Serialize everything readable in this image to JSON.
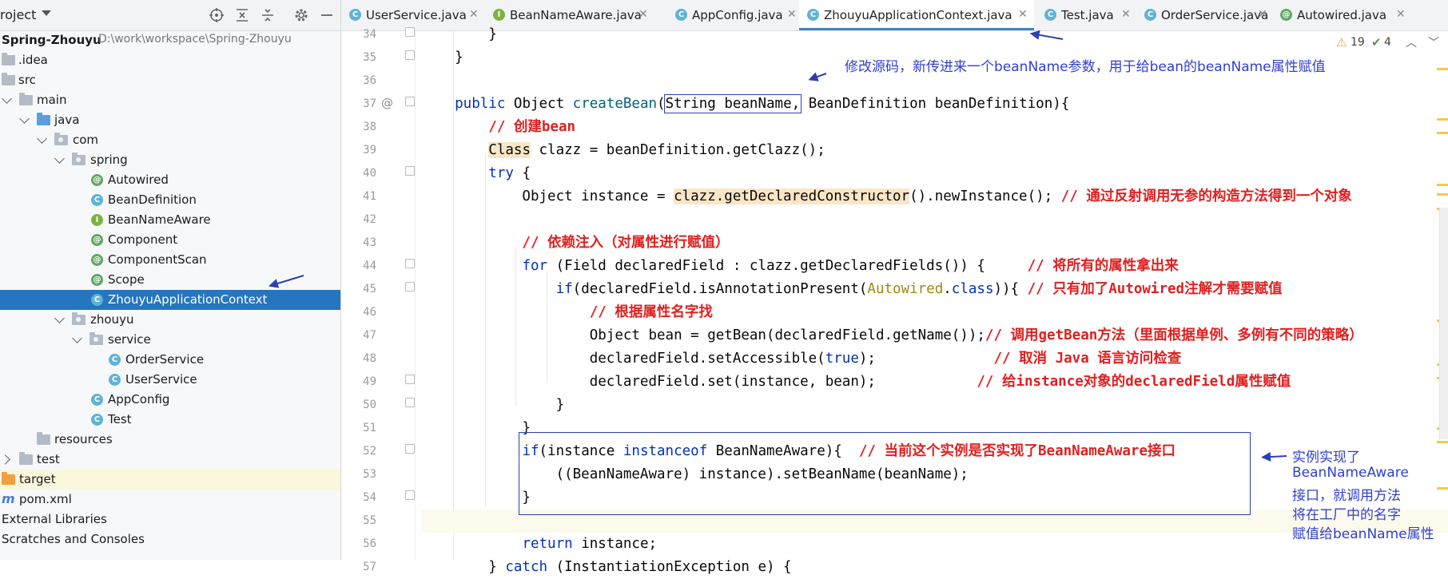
{
  "project_panel": {
    "title": "roject",
    "root": {
      "name": "Spring-Zhouyu",
      "path": "D:\\work\\workspace\\Spring-Zhouyu"
    },
    "tree": [
      {
        "label": ".idea",
        "kind": "folder"
      },
      {
        "label": "src",
        "kind": "folder"
      },
      {
        "label": "main",
        "kind": "folder"
      },
      {
        "label": "java",
        "kind": "src-folder"
      },
      {
        "label": "com",
        "kind": "package"
      },
      {
        "label": "spring",
        "kind": "package"
      },
      {
        "label": "Autowired",
        "kind": "annotation"
      },
      {
        "label": "BeanDefinition",
        "kind": "class"
      },
      {
        "label": "BeanNameAware",
        "kind": "interface"
      },
      {
        "label": "Component",
        "kind": "annotation"
      },
      {
        "label": "ComponentScan",
        "kind": "annotation"
      },
      {
        "label": "Scope",
        "kind": "annotation"
      },
      {
        "label": "ZhouyuApplicationContext",
        "kind": "class"
      },
      {
        "label": "zhouyu",
        "kind": "package"
      },
      {
        "label": "service",
        "kind": "package"
      },
      {
        "label": "OrderService",
        "kind": "class"
      },
      {
        "label": "UserService",
        "kind": "class"
      },
      {
        "label": "AppConfig",
        "kind": "class"
      },
      {
        "label": "Test",
        "kind": "class"
      },
      {
        "label": "resources",
        "kind": "folder"
      },
      {
        "label": "test",
        "kind": "folder"
      },
      {
        "label": "target",
        "kind": "target-folder"
      },
      {
        "label": "pom.xml",
        "kind": "maven"
      },
      {
        "label": "External Libraries",
        "kind": "libs"
      },
      {
        "label": "Scratches and Consoles",
        "kind": "scratch"
      }
    ],
    "selected": "ZhouyuApplicationContext"
  },
  "tabs": [
    {
      "label": "UserService.java",
      "icon": "class-icon",
      "active": false
    },
    {
      "label": "BeanNameAware.java",
      "icon": "interface-icon",
      "active": false
    },
    {
      "label": "AppConfig.java",
      "icon": "class-icon",
      "active": false
    },
    {
      "label": "ZhouyuApplicationContext.java",
      "icon": "class-icon",
      "active": true
    },
    {
      "label": "Test.java",
      "icon": "class-icon",
      "active": false
    },
    {
      "label": "OrderService.java",
      "icon": "class-icon",
      "active": false
    },
    {
      "label": "Autowired.java",
      "icon": "annotation-icon",
      "active": false
    }
  ],
  "inspections": {
    "warnings": "19",
    "ok": "4"
  },
  "line_numbers": [
    "34",
    "35",
    "36",
    "37",
    "38",
    "39",
    "40",
    "41",
    "42",
    "43",
    "44",
    "45",
    "46",
    "47",
    "48",
    "49",
    "50",
    "51",
    "52",
    "53",
    "54",
    "55",
    "56",
    "57"
  ],
  "code": {
    "l34": "        }",
    "l35": "    }",
    "l37_a": "    public ",
    "l37_b": "Object ",
    "l37_c": "createBean",
    "l37_d": "(",
    "l37_e": "String beanName,",
    "l37_f": " BeanDefinition beanDefinition){",
    "l38": "        // 创建bean",
    "l39_a": "        ",
    "l39_b": "Class",
    "l39_c": " clazz = beanDefinition.getClazz();",
    "l40_a": "        ",
    "l40_b": "try",
    "l40_c": " {",
    "l41_a": "            Object instance = ",
    "l41_b": "clazz.getDeclaredConstructor",
    "l41_c": "().newInstance(); ",
    "l41_d": "// 通过反射调用无参的构造方法得到一个对象",
    "l43": "            // 依赖注入（对属性进行赋值）",
    "l44_a": "            ",
    "l44_b": "for",
    "l44_c": " (Field declaredField : clazz.getDeclaredFields()) {     ",
    "l44_d": "// 将所有的属性拿出来",
    "l45_a": "                ",
    "l45_b": "if",
    "l45_c": "(declaredField.isAnnotationPresent(",
    "l45_d": "Autowired",
    "l45_e": ".",
    "l45_f": "class",
    "l45_g": ")){ ",
    "l45_h": "// 只有加了Autowired注解才需要赋值",
    "l46": "                    // 根据属性名字找",
    "l47_a": "                    Object bean = getBean(declaredField.getName());",
    "l47_b": "// 调用getBean方法（里面根据单例、多例有不同的策略）",
    "l48_a": "                    declaredField.setAccessible(",
    "l48_b": "true",
    "l48_c": ");              ",
    "l48_d": "// 取消 Java 语言访问检查",
    "l49_a": "                    declaredField.set(instance, bean);            ",
    "l49_b": "// 给instance对象的declaredField属性赋值",
    "l50": "                }",
    "l51": "            }",
    "l52_a": "            ",
    "l52_b": "if",
    "l52_c": "(instance ",
    "l52_d": "instanceof",
    "l52_e": " BeanNameAware){  ",
    "l52_f": "// 当前这个实例是否实现了BeanNameAware接口",
    "l53": "                ((BeanNameAware) instance).setBeanName(beanName);",
    "l54": "            }",
    "l56_a": "            ",
    "l56_b": "return",
    "l56_c": " instance;",
    "l57_a": "        } ",
    "l57_b": "catch",
    "l57_c": " (InstantiationException e) {"
  },
  "annotations": {
    "top_note": "修改源码，新传进来一个beanName参数，用于给bean的beanName属性赋值",
    "side_note": [
      "实例实现了",
      "BeanNameAware",
      "接口，就调用方法",
      "将在工厂中的名字",
      "赋值给beanName属性"
    ]
  }
}
